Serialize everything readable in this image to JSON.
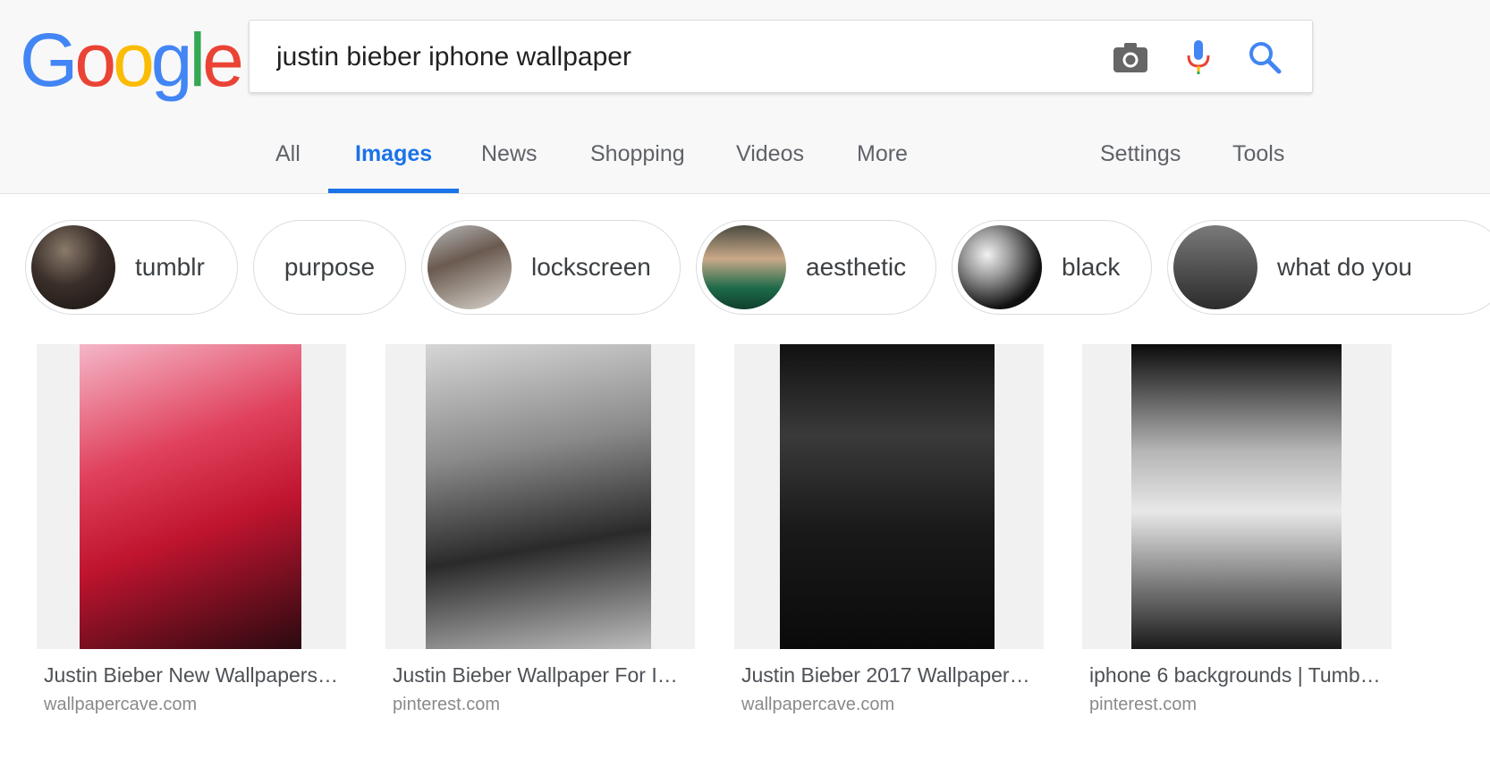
{
  "logo": {
    "letters": [
      "G",
      "o",
      "o",
      "g",
      "l",
      "e"
    ]
  },
  "search": {
    "query": "justin bieber iphone wallpaper"
  },
  "icons": {
    "camera": "camera-icon",
    "mic": "microphone-icon",
    "search": "search-icon"
  },
  "tabs": [
    {
      "label": "All"
    },
    {
      "label": "Images",
      "active": true
    },
    {
      "label": "News"
    },
    {
      "label": "Shopping"
    },
    {
      "label": "Videos"
    },
    {
      "label": "More"
    },
    {
      "label": "Settings"
    },
    {
      "label": "Tools"
    }
  ],
  "chips": [
    {
      "label": "tumblr"
    },
    {
      "label": "purpose"
    },
    {
      "label": "lockscreen"
    },
    {
      "label": "aesthetic"
    },
    {
      "label": "black"
    },
    {
      "label": "what do you"
    }
  ],
  "results": [
    {
      "title": "Justin Bieber New Wallpapers…",
      "site": "wallpapercave.com"
    },
    {
      "title": "Justin Bieber Wallpaper For Ip…",
      "site": "pinterest.com"
    },
    {
      "title": "Justin Bieber 2017 Wallpaper…",
      "site": "wallpapercave.com"
    },
    {
      "title": "iphone 6 backgrounds | Tumbl…",
      "site": "pinterest.com"
    }
  ],
  "colors": {
    "accent": "#1a73e8",
    "google_blue": "#4285f4",
    "google_red": "#ea4335",
    "google_yellow": "#fbbc05",
    "google_green": "#34a853"
  }
}
